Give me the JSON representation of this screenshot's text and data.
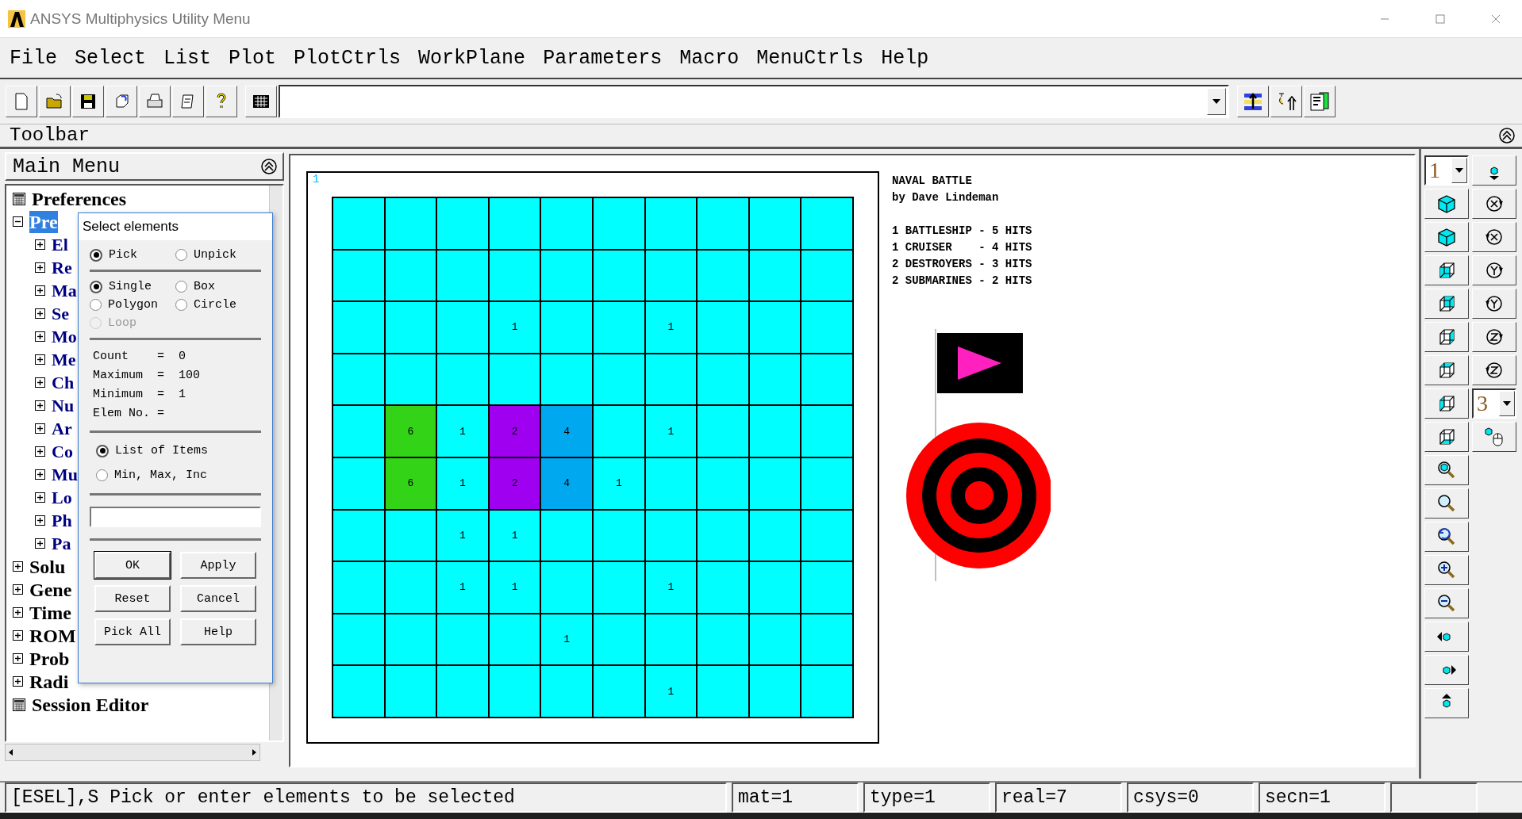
{
  "window": {
    "title": "ANSYS Multiphysics Utility Menu"
  },
  "menu": [
    "File",
    "Select",
    "List",
    "Plot",
    "PlotCtrls",
    "WorkPlane",
    "Parameters",
    "Macro",
    "MenuCtrls",
    "Help"
  ],
  "toolbar": {
    "label": "Toolbar"
  },
  "main_menu": {
    "title": "Main Menu",
    "tree": [
      {
        "kind": "leaf",
        "label": "Preferences",
        "selected": false
      },
      {
        "kind": "folder",
        "label": "Pre",
        "expanded": true,
        "selected": true,
        "children": [
          {
            "kind": "folder",
            "label": "El",
            "expanded": false,
            "selected": false
          },
          {
            "kind": "folder",
            "label": "Re",
            "expanded": false,
            "selected": false
          },
          {
            "kind": "folder",
            "label": "Ma",
            "expanded": false,
            "selected": false
          },
          {
            "kind": "folder",
            "label": "Se",
            "expanded": false,
            "selected": false
          },
          {
            "kind": "folder",
            "label": "Mo",
            "expanded": false,
            "selected": false
          },
          {
            "kind": "folder",
            "label": "Me",
            "expanded": false,
            "selected": false
          },
          {
            "kind": "folder",
            "label": "Ch",
            "expanded": false,
            "selected": false
          },
          {
            "kind": "folder",
            "label": "Nu",
            "expanded": false,
            "selected": false
          },
          {
            "kind": "folder",
            "label": "Ar",
            "expanded": false,
            "selected": false
          },
          {
            "kind": "folder",
            "label": "Co",
            "expanded": false,
            "selected": false
          },
          {
            "kind": "folder",
            "label": "Mu",
            "expanded": false,
            "selected": false
          },
          {
            "kind": "folder",
            "label": "Lo",
            "expanded": false,
            "selected": false
          },
          {
            "kind": "folder",
            "label": "Ph",
            "expanded": false,
            "selected": false
          },
          {
            "kind": "folder",
            "label": "Pa",
            "expanded": false,
            "selected": false
          }
        ]
      },
      {
        "kind": "folder",
        "label": "Solu",
        "expanded": false,
        "selected": false
      },
      {
        "kind": "folder",
        "label": "Gene",
        "expanded": false,
        "selected": false
      },
      {
        "kind": "folder",
        "label": "Time",
        "expanded": false,
        "selected": false
      },
      {
        "kind": "folder",
        "label": "ROM",
        "expanded": false,
        "selected": false
      },
      {
        "kind": "folder",
        "label": "Prob",
        "expanded": false,
        "selected": false
      },
      {
        "kind": "folder",
        "label": "Radi",
        "expanded": false,
        "selected": false
      },
      {
        "kind": "leaf",
        "label": "Session Editor",
        "selected": false
      }
    ]
  },
  "dialog": {
    "title": "Select elements",
    "pick_mode": [
      {
        "label": "Pick",
        "selected": true,
        "disabled": false
      },
      {
        "label": "Unpick",
        "selected": false,
        "disabled": false
      }
    ],
    "pick_shape": [
      {
        "label": "Single",
        "selected": true,
        "disabled": false
      },
      {
        "label": "Box",
        "selected": false,
        "disabled": false
      },
      {
        "label": "Polygon",
        "selected": false,
        "disabled": false
      },
      {
        "label": "Circle",
        "selected": false,
        "disabled": false
      },
      {
        "label": "Loop",
        "selected": false,
        "disabled": true
      }
    ],
    "counts": [
      "Count    =  0",
      "Maximum  =  100",
      "Minimum  =  1",
      "Elem No. ="
    ],
    "entry_mode": [
      {
        "label": "List of Items",
        "selected": true,
        "disabled": false
      },
      {
        "label": "Min, Max, Inc",
        "selected": false,
        "disabled": false
      }
    ],
    "buttons": [
      "OK",
      "Apply",
      "Reset",
      "Cancel",
      "Pick All",
      "Help"
    ]
  },
  "graphics": {
    "window_number": "1",
    "grid": [
      [
        {
          "color": "#00ffff"
        },
        {
          "color": "#00ffff"
        },
        {
          "color": "#00ffff"
        },
        {
          "color": "#00ffff"
        },
        {
          "color": "#00ffff"
        },
        {
          "color": "#00ffff"
        },
        {
          "color": "#00ffff"
        },
        {
          "color": "#00ffff"
        },
        {
          "color": "#00ffff"
        },
        {
          "color": "#00ffff"
        }
      ],
      [
        {
          "color": "#00ffff"
        },
        {
          "color": "#00ffff"
        },
        {
          "color": "#00ffff"
        },
        {
          "color": "#00ffff"
        },
        {
          "color": "#00ffff"
        },
        {
          "color": "#00ffff"
        },
        {
          "color": "#00ffff"
        },
        {
          "color": "#00ffff"
        },
        {
          "color": "#00ffff"
        },
        {
          "color": "#00ffff"
        }
      ],
      [
        {
          "color": "#00ffff"
        },
        {
          "color": "#00ffff"
        },
        {
          "color": "#00ffff"
        },
        {
          "text": "1",
          "color": "#00ffff"
        },
        {
          "color": "#00ffff"
        },
        {
          "color": "#00ffff"
        },
        {
          "text": "1",
          "color": "#00ffff"
        },
        {
          "color": "#00ffff"
        },
        {
          "color": "#00ffff"
        },
        {
          "color": "#00ffff"
        }
      ],
      [
        {
          "color": "#00ffff"
        },
        {
          "color": "#00ffff"
        },
        {
          "color": "#00ffff"
        },
        {
          "color": "#00ffff"
        },
        {
          "color": "#00ffff"
        },
        {
          "color": "#00ffff"
        },
        {
          "color": "#00ffff"
        },
        {
          "color": "#00ffff"
        },
        {
          "color": "#00ffff"
        },
        {
          "color": "#00ffff"
        }
      ],
      [
        {
          "color": "#00ffff"
        },
        {
          "text": "6",
          "color": "#33d418"
        },
        {
          "text": "1",
          "color": "#00ffff"
        },
        {
          "text": "2",
          "color": "#a000f0"
        },
        {
          "text": "4",
          "color": "#00a8f0"
        },
        {
          "color": "#00ffff"
        },
        {
          "text": "1",
          "color": "#00ffff"
        },
        {
          "color": "#00ffff"
        },
        {
          "color": "#00ffff"
        },
        {
          "color": "#00ffff"
        }
      ],
      [
        {
          "color": "#00ffff"
        },
        {
          "text": "6",
          "color": "#33d418"
        },
        {
          "text": "1",
          "color": "#00ffff"
        },
        {
          "text": "2",
          "color": "#a000f0"
        },
        {
          "text": "4",
          "color": "#00a8f0"
        },
        {
          "text": "1",
          "color": "#00ffff"
        },
        {
          "color": "#00ffff"
        },
        {
          "color": "#00ffff"
        },
        {
          "color": "#00ffff"
        },
        {
          "color": "#00ffff"
        }
      ],
      [
        {
          "color": "#00ffff"
        },
        {
          "color": "#00ffff"
        },
        {
          "text": "1",
          "color": "#00ffff"
        },
        {
          "text": "1",
          "color": "#00ffff"
        },
        {
          "color": "#00ffff"
        },
        {
          "color": "#00ffff"
        },
        {
          "color": "#00ffff"
        },
        {
          "color": "#00ffff"
        },
        {
          "color": "#00ffff"
        },
        {
          "color": "#00ffff"
        }
      ],
      [
        {
          "color": "#00ffff"
        },
        {
          "color": "#00ffff"
        },
        {
          "text": "1",
          "color": "#00ffff"
        },
        {
          "text": "1",
          "color": "#00ffff"
        },
        {
          "color": "#00ffff"
        },
        {
          "color": "#00ffff"
        },
        {
          "text": "1",
          "color": "#00ffff"
        },
        {
          "color": "#00ffff"
        },
        {
          "color": "#00ffff"
        },
        {
          "color": "#00ffff"
        }
      ],
      [
        {
          "color": "#00ffff"
        },
        {
          "color": "#00ffff"
        },
        {
          "color": "#00ffff"
        },
        {
          "color": "#00ffff"
        },
        {
          "text": "1",
          "color": "#00ffff"
        },
        {
          "color": "#00ffff"
        },
        {
          "color": "#00ffff"
        },
        {
          "color": "#00ffff"
        },
        {
          "color": "#00ffff"
        },
        {
          "color": "#00ffff"
        }
      ],
      [
        {
          "color": "#00ffff"
        },
        {
          "color": "#00ffff"
        },
        {
          "color": "#00ffff"
        },
        {
          "color": "#00ffff"
        },
        {
          "color": "#00ffff"
        },
        {
          "color": "#00ffff"
        },
        {
          "text": "1",
          "color": "#00ffff"
        },
        {
          "color": "#00ffff"
        },
        {
          "color": "#00ffff"
        },
        {
          "color": "#00ffff"
        }
      ]
    ],
    "legend": [
      "NAVAL BATTLE",
      "by Dave Lindeman"
    ],
    "ships": [
      "1 BATTLESHIP - 5 HITS",
      "1 CRUISER    - 4 HITS",
      "2 DESTROYERS - 3 HITS",
      "2 SUBMARINES - 2 HITS"
    ]
  },
  "right_toolbar": {
    "view_number": "1",
    "increment": "3"
  },
  "status_bar": [
    "[ESEL],S  Pick or enter elements to be selected",
    "mat=1",
    "type=1",
    "real=7",
    "csys=0",
    "secn=1"
  ]
}
